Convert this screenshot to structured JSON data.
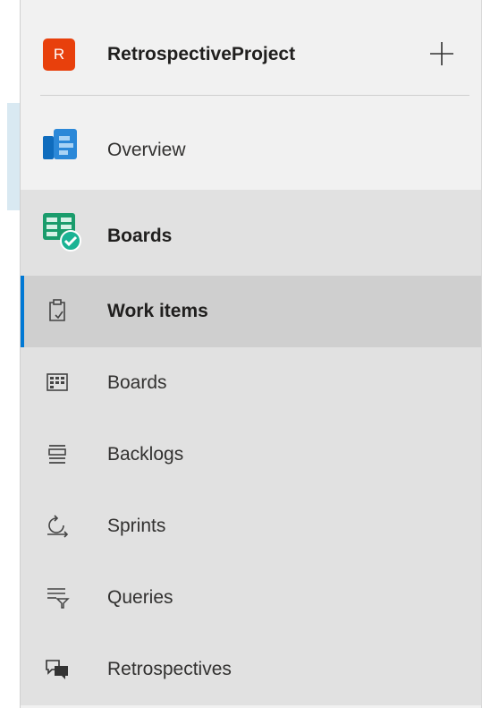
{
  "project": {
    "avatar_letter": "R",
    "name": "RetrospectiveProject"
  },
  "nav": {
    "overview_label": "Overview",
    "boards_hub_label": "Boards",
    "items": [
      {
        "label": "Work items",
        "icon": "clipboard-icon",
        "selected": true
      },
      {
        "label": "Boards",
        "icon": "board-grid-icon",
        "selected": false
      },
      {
        "label": "Backlogs",
        "icon": "backlog-icon",
        "selected": false
      },
      {
        "label": "Sprints",
        "icon": "sprint-cycle-icon",
        "selected": false
      },
      {
        "label": "Queries",
        "icon": "query-filter-icon",
        "selected": false
      },
      {
        "label": "Retrospectives",
        "icon": "retrospective-chat-icon",
        "selected": false
      }
    ]
  },
  "colors": {
    "accent": "#0078d4",
    "avatar": "#e8400c",
    "selected_bg": "#cfcfcf",
    "boards_section_bg": "#e1e1e1"
  }
}
